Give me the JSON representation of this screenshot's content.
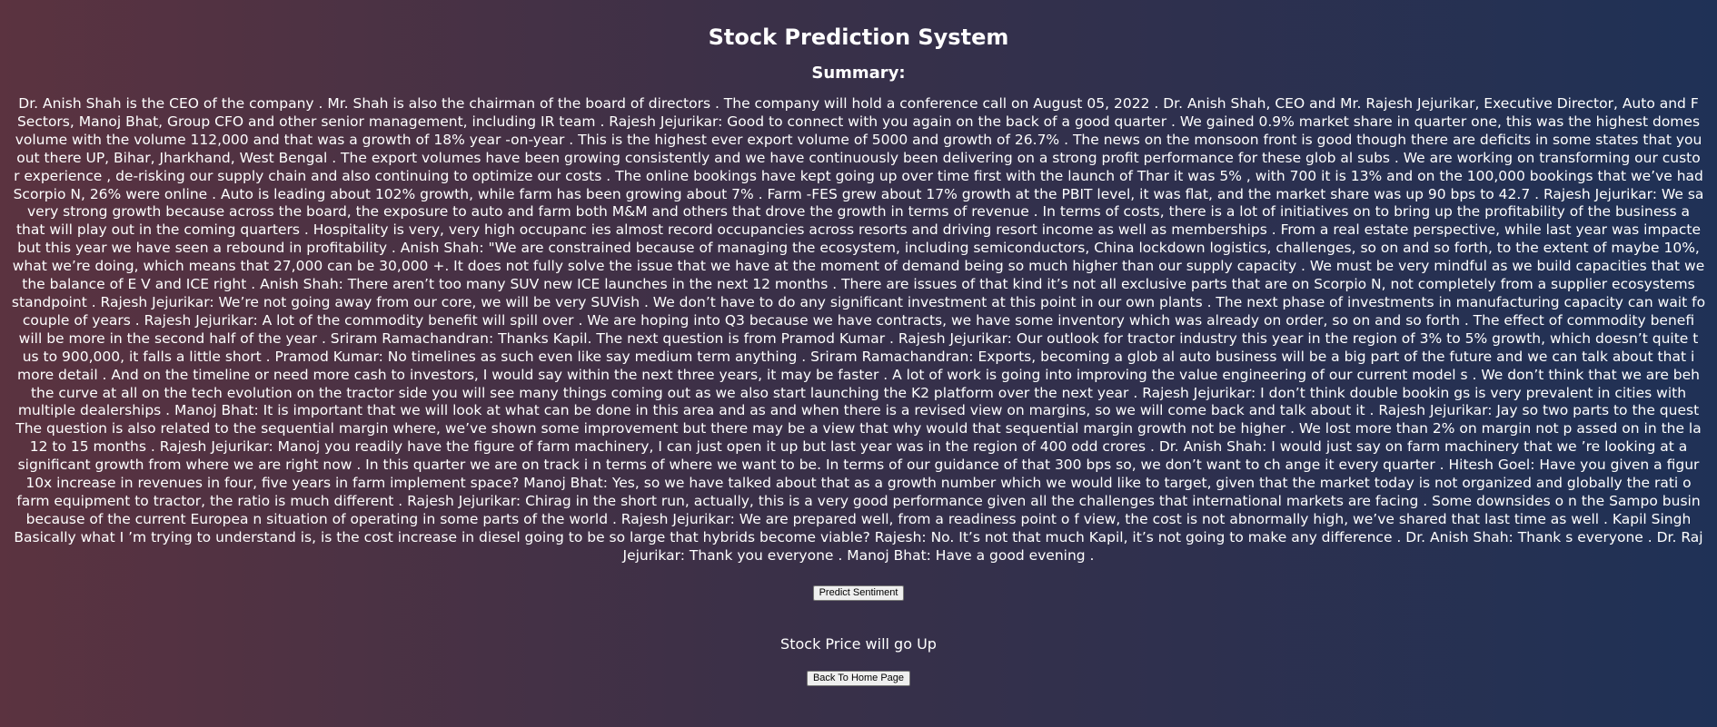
{
  "page": {
    "title": "Stock Prediction System",
    "summary_heading": "Summary:"
  },
  "summary_lines": [
    "Dr. Anish Shah is the CEO of the company . Mr. Shah is also the chairman of the board of directors . The company will hold a conference call on August 05, 2022 . Dr. Anish Shah, CEO and Mr. Rajesh Jejurikar, Executive Director, Auto and F",
    "Sectors, Manoj Bhat, Group CFO and other senior management, including IR team . Rajesh Jejurikar: Good to connect with you again on the back of a good quarter . We gained 0.9% market share in quarter one, this was the highest domes",
    "volume with the volume 112,000 and that was a growth of 18% year -on-year . This is the highest ever export volume of 5000 and growth of 26.7% . The news on the monsoon front is good though there are deficits in some states that you",
    "out there UP, Bihar, Jharkhand, West Bengal . The export volumes have been growing consistently and we have continuously been delivering on a strong profit performance for these glob al subs . We are working on transforming our custo",
    "r experience , de-risking our supply chain and also continuing to optimize our costs . The online bookings have kept going up over time first with the launch of Thar it was 5% , with 700 it is 13% and on the 100,000 bookings that we’ve had",
    "Scorpio N, 26% were online . Auto is leading about 102% growth, while farm has been growing about 7% . Farm -FES grew about 17% growth at the PBIT level, it was flat, and the market share was up 90 bps to 42.7 . Rajesh Jejurikar: We sa",
    "very strong growth because across the board, the exposure to auto and farm both M&M and others that drove the growth in terms of revenue . In terms of costs, there is a lot of initiatives on to bring up the profitability of the business a",
    "that will play out in the coming quarters . Hospitality is very, very high occupanc ies almost record occupancies across resorts and driving resort income as well as memberships . From a real estate perspective, while last year was impacte",
    "but this year we have seen a rebound in profitability . Anish Shah: \"We are constrained because of managing the ecosystem, including semiconductors, China lockdown logistics, challenges, so on and so forth, to the extent of maybe 10%,",
    "what we’re doing, which means that 27,000 can be 30,000 +. It does not fully solve the issue that we have at the moment of demand being so much higher than our supply capacity . We must be very mindful as we build capacities that we",
    "the balance of E V and ICE right . Anish Shah: There aren’t too many SUV new ICE launches in the next 12 months . There are issues of that kind it’s not all exclusive parts that are on Scorpio N, not completely from a supplier ecosystems",
    "standpoint . Rajesh Jejurikar: We’re not going away from our core, we will be very SUVish . We don’t have to do any significant investment at this point in our own plants . The next phase of investments in manufacturing capacity can wait fo",
    "couple of years . Rajesh Jejurikar: A lot of the commodity benefit will spill over . We are hoping into Q3 because we have contracts, we have some inventory which was already on order, so on and so forth . The effect of commodity benefi",
    "will be more in the second half of the year . Sriram Ramachandran: Thanks Kapil. The next question is from Pramod Kumar . Rajesh Jejurikar: Our outlook for tractor industry this year in the region of 3% to 5% growth, which doesn’t quite t",
    "us to 900,000, it falls a little short . Pramod Kumar: No timelines as such even like say medium term anything . Sriram Ramachandran: Exports, becoming a glob al auto business will be a big part of the future and we can talk about that i",
    "more detail . And on the timeline or need more cash to investors, I would say within the next three years, it may be faster . A lot of work is going into improving the value engineering of our current model s . We don’t think that we are beh",
    "the curve at all on the tech evolution on the tractor side you will see many things coming out as we also start launching the K2 platform over the next year . Rajesh Jejurikar: I don’t think double bookin gs is very prevalent in cities with",
    "multiple dealerships . Manoj Bhat: It is important that we will look at what can be done in this area and as and when there is a revised view on margins, so we will come back and talk about it . Rajesh Jejurikar: Jay so two parts to the quest",
    "The question is also related to the sequential margin where, we’ve shown some improvement but there may be a view that why would that sequential margin growth not be higher . We lost more than 2% on margin not p assed on in the la",
    "12 to 15 months . Rajesh Jejurikar: Manoj you readily have the figure of farm machinery, I can just open it up but last year was in the region of 400 odd crores . Dr. Anish Shah: I would just say on farm machinery that we ’re looking at a",
    "significant growth from where we are right now . In this quarter we are on track i n terms of where we want to be. In terms of our guidance of that 300 bps so, we don’t want to ch ange it every quarter . Hitesh Goel: Have you given a figur",
    "10x increase in revenues in four, five years in farm implement space? Manoj Bhat: Yes, so we have talked about that as a growth number which we would like to target, given that the market today is not organized and globally the rati o",
    "farm equipment to tractor, the ratio is much different . Rajesh Jejurikar: Chirag in the short run, actually, this is a very good performance given all the challenges that international markets are facing . Some downsides o n the Sampo busin",
    "because of the current Europea n situation of operating in some parts of the world . Rajesh Jejurikar: We are prepared well, from a readiness point o f view, the cost is not abnormally high, we’ve shared that last time as well . Kapil Singh",
    "Basically what I ’m trying to understand is, is the cost increase in diesel going to be so large that hybrids become viable? Rajesh: No. It’s not that much Kapil, it’s not going to make any difference . Dr. Anish Shah: Thank s everyone . Dr. Raj",
    "Jejurikar: Thank you everyone . Manoj Bhat: Have a good evening ."
  ],
  "buttons": {
    "predict_label": "Predict Sentiment",
    "home_label": "Back To Home Page"
  },
  "result": {
    "text": "Stock Price will go Up"
  }
}
